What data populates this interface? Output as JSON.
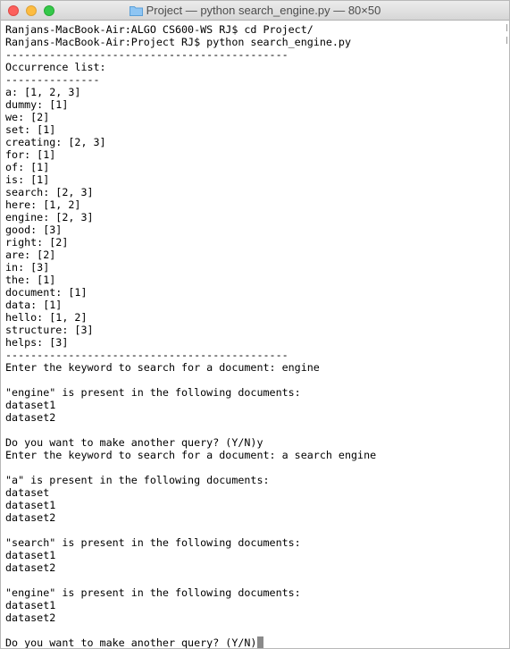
{
  "window": {
    "title": "Project — python search_engine.py — 80×50"
  },
  "terminal": {
    "lines": [
      "Ranjans-MacBook-Air:ALGO CS600-WS RJ$ cd Project/",
      "Ranjans-MacBook-Air:Project RJ$ python search_engine.py",
      "---------------------------------------------",
      "Occurrence list:",
      "---------------",
      "a: [1, 2, 3]",
      "dummy: [1]",
      "we: [2]",
      "set: [1]",
      "creating: [2, 3]",
      "for: [1]",
      "of: [1]",
      "is: [1]",
      "search: [2, 3]",
      "here: [1, 2]",
      "engine: [2, 3]",
      "good: [3]",
      "right: [2]",
      "are: [2]",
      "in: [3]",
      "the: [1]",
      "document: [1]",
      "data: [1]",
      "hello: [1, 2]",
      "structure: [3]",
      "helps: [3]",
      "---------------------------------------------",
      "Enter the keyword to search for a document: engine",
      "",
      "\"engine\" is present in the following documents:",
      "dataset1",
      "dataset2",
      "",
      "Do you want to make another query? (Y/N)y",
      "Enter the keyword to search for a document: a search engine",
      "",
      "\"a\" is present in the following documents:",
      "dataset",
      "dataset1",
      "dataset2",
      "",
      "\"search\" is present in the following documents:",
      "dataset1",
      "dataset2",
      "",
      "\"engine\" is present in the following documents:",
      "dataset1",
      "dataset2",
      "",
      "Do you want to make another query? (Y/N)"
    ]
  },
  "colors": {
    "close": "#fc605c",
    "minimize": "#fdbc40",
    "maximize": "#34c84a",
    "background": "#ffffff",
    "text": "#000000",
    "cursor": "#8a8a8a"
  },
  "icons": {
    "folder": "folder-icon"
  }
}
